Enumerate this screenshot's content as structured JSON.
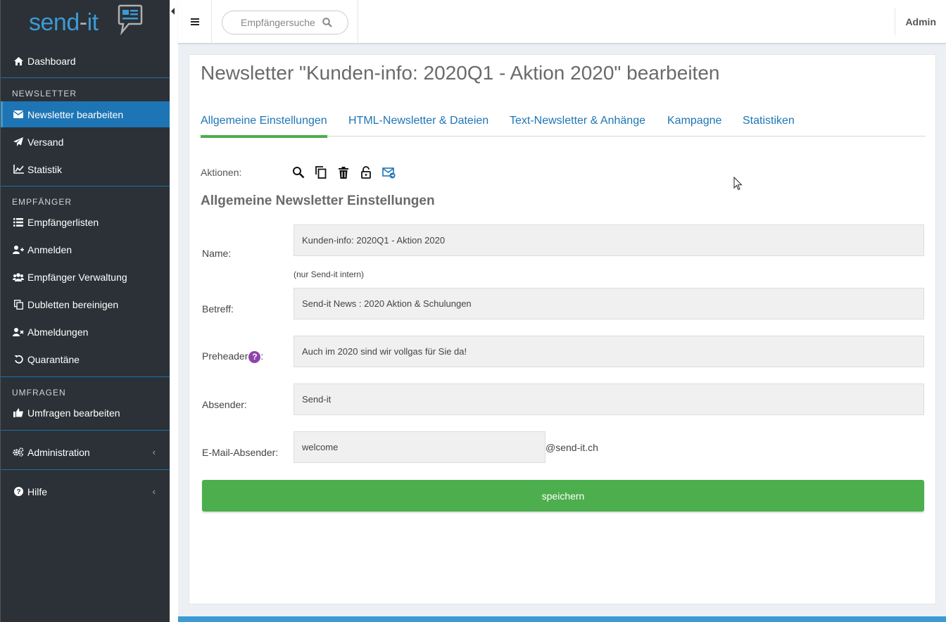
{
  "brand": {
    "send": "send",
    "dash": "-",
    "it": "it"
  },
  "colors": {
    "sidebar_bg": "#2b3137",
    "active_bg": "#1e75b5",
    "accent_blue": "#3c9ad4",
    "save_green": "#4cae4c",
    "help_purple": "#8e44ad"
  },
  "sidebar": {
    "dashboard": {
      "label": "Dashboard",
      "icon": "home-icon"
    },
    "sections": {
      "newsletter": "NEWSLETTER",
      "empfaenger": "EMPFÄNGER",
      "umfragen": "UMFRAGEN"
    },
    "items": [
      {
        "label": "Newsletter bearbeiten",
        "icon": "envelope-icon",
        "active": true
      },
      {
        "label": "Versand",
        "icon": "paper-plane-icon"
      },
      {
        "label": "Statistik",
        "icon": "line-chart-icon"
      },
      {
        "label": "Empfängerlisten",
        "icon": "list-icon"
      },
      {
        "label": "Anmelden",
        "icon": "user-plus-icon"
      },
      {
        "label": "Empfänger Verwaltung",
        "icon": "users-icon"
      },
      {
        "label": "Dubletten bereinigen",
        "icon": "copy-icon"
      },
      {
        "label": "Abmeldungen",
        "icon": "user-times-icon"
      },
      {
        "label": "Quarantäne",
        "icon": "undo-icon"
      },
      {
        "label": "Umfragen bearbeiten",
        "icon": "thumbs-up-icon"
      },
      {
        "label": "Administration",
        "icon": "cogs-icon"
      },
      {
        "label": "Hilfe",
        "icon": "question-circle-icon"
      }
    ]
  },
  "topbar": {
    "search_placeholder": "Empfängersuche",
    "user": "Admin"
  },
  "page": {
    "title": "Newsletter \"Kunden-info: 2020Q1 - Aktion 2020\" bearbeiten",
    "tabs": [
      {
        "label": "Allgemeine Einstellungen",
        "active": true
      },
      {
        "label": "HTML-Newsletter & Dateien"
      },
      {
        "label": "Text-Newsletter & Anhänge"
      },
      {
        "label": "Kampagne"
      },
      {
        "label": "Statistiken"
      }
    ],
    "actions_label": "Aktionen:",
    "actions": [
      "search-icon",
      "copy-icon",
      "trash-icon",
      "lock-icon",
      "mail-send-icon"
    ],
    "section_title": "Allgemeine Newsletter Einstellungen",
    "form": {
      "name": {
        "label": "Name:",
        "value": "Kunden-info: 2020Q1 - Aktion 2020",
        "hint": "(nur Send-it intern)"
      },
      "betreff": {
        "label": "Betreff:",
        "value": "Send-it News : 2020 Aktion & Schulungen"
      },
      "preheader": {
        "label": "Preheader",
        "help": "?",
        "colon": ":",
        "value": "Auch im 2020 sind wir vollgas für Sie da!"
      },
      "absender": {
        "label": "Absender:",
        "value": "Send-it"
      },
      "email": {
        "label": "E-Mail-Absender:",
        "value": "welcome",
        "domain": "@send-it.ch"
      }
    },
    "save_label": "speichern"
  }
}
